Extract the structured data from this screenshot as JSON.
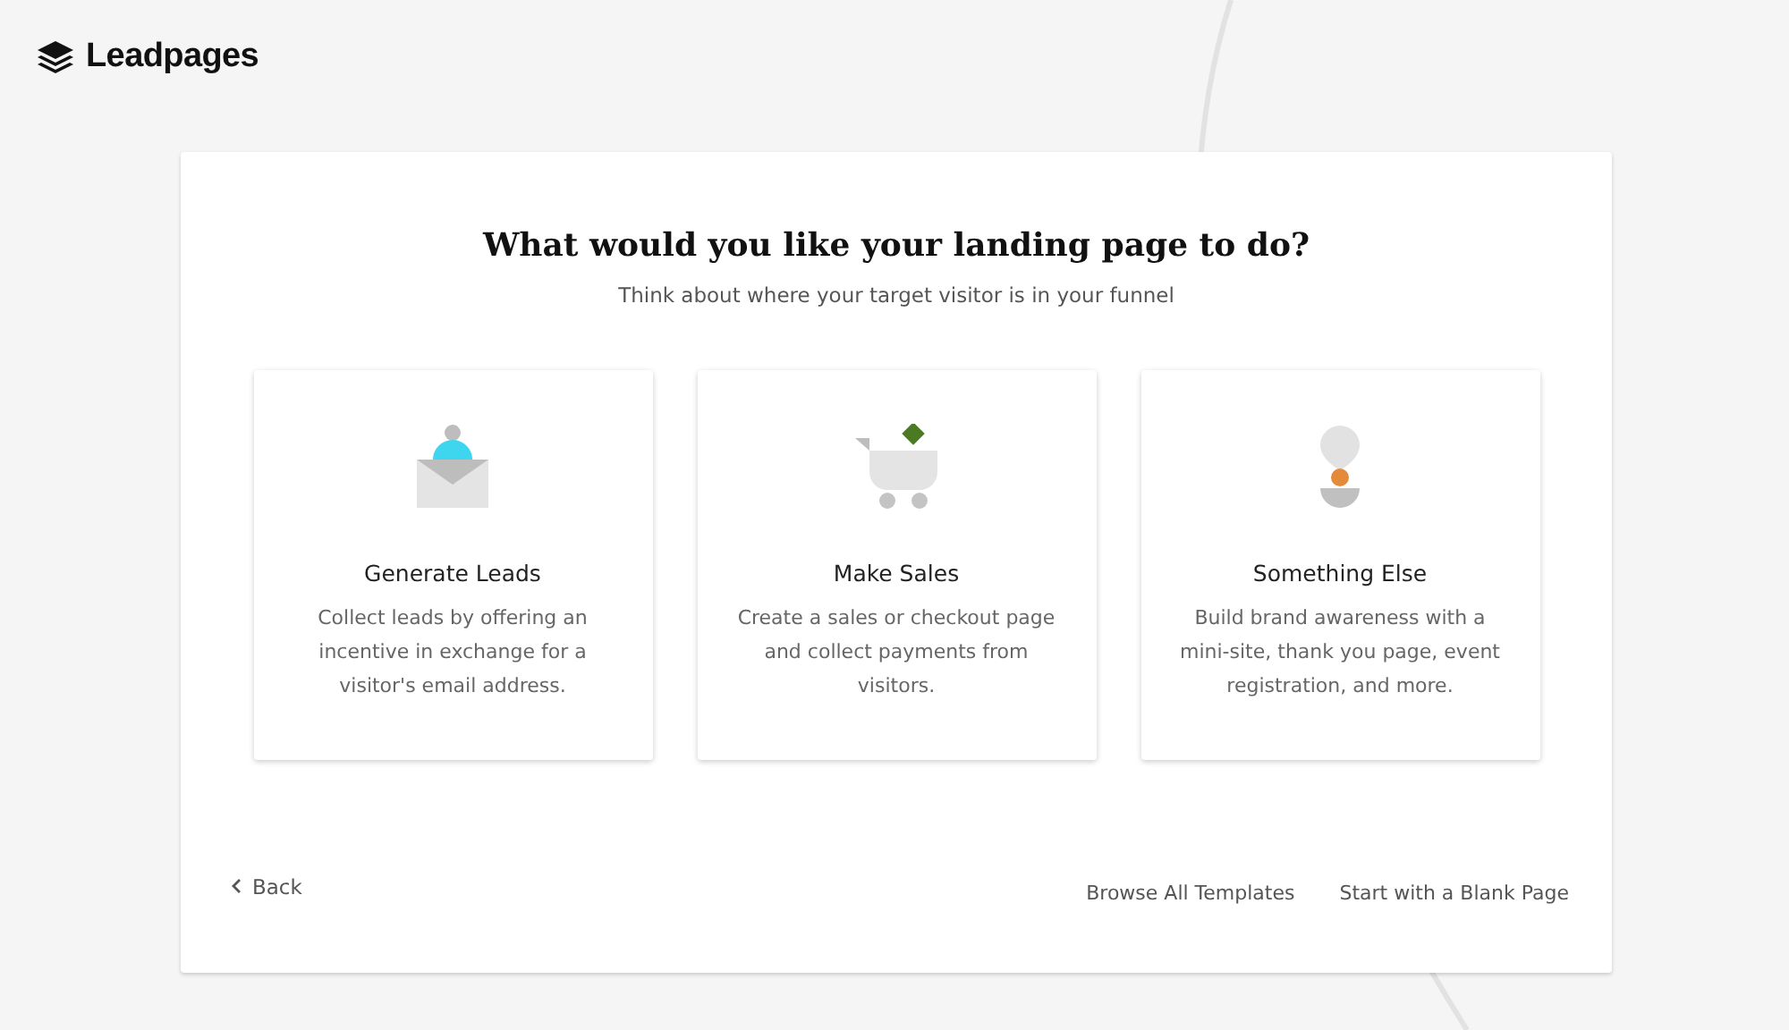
{
  "brand": {
    "name": "Leadpages"
  },
  "dialog": {
    "title": "What would you like your landing page to do?",
    "subtitle": "Think about where your target visitor is in your funnel"
  },
  "options": [
    {
      "kind": "leads",
      "title": "Generate Leads",
      "description": "Collect leads by offering an incentive in exchange for a visitor's email address."
    },
    {
      "kind": "sales",
      "title": "Make Sales",
      "description": "Create a sales or checkout page and collect payments from visitors."
    },
    {
      "kind": "other",
      "title": "Something Else",
      "description": "Build brand awareness with a mini-site, thank you page, event registration, and more."
    }
  ],
  "footer": {
    "back": "Back",
    "links": [
      "Browse All Templates",
      "Start with a Blank Page"
    ]
  }
}
